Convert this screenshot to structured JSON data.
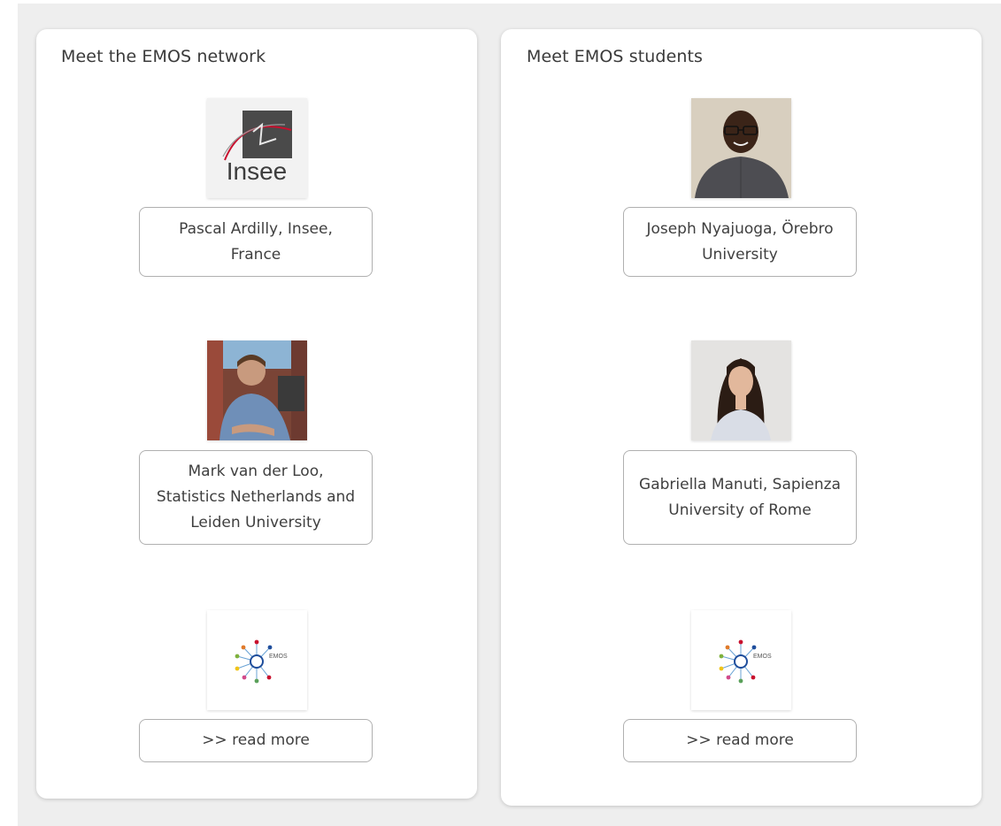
{
  "network": {
    "title": "Meet the EMOS network",
    "entries": [
      {
        "label": "Pascal Ardilly, Insee, France",
        "image": "insee-logo"
      },
      {
        "label": "Mark van der Loo, Statistics Netherlands and Leiden University",
        "image": "person-photo"
      },
      {
        "label": ">> read more",
        "image": "emos-logo"
      }
    ]
  },
  "students": {
    "title": "Meet EMOS students",
    "entries": [
      {
        "label": "Joseph Nyajuoga, Örebro University",
        "image": "person-photo"
      },
      {
        "label": "Gabriella Manuti, Sapienza University of Rome",
        "image": "person-photo"
      },
      {
        "label": ">> read more",
        "image": "emos-logo"
      }
    ]
  },
  "logos": {
    "insee_text": "Insee",
    "emos_text": "EMOS"
  },
  "colors": {
    "insee_red": "#c8102e",
    "insee_dark": "#3d3d3d",
    "emos_ring": "#1f4e9c"
  }
}
